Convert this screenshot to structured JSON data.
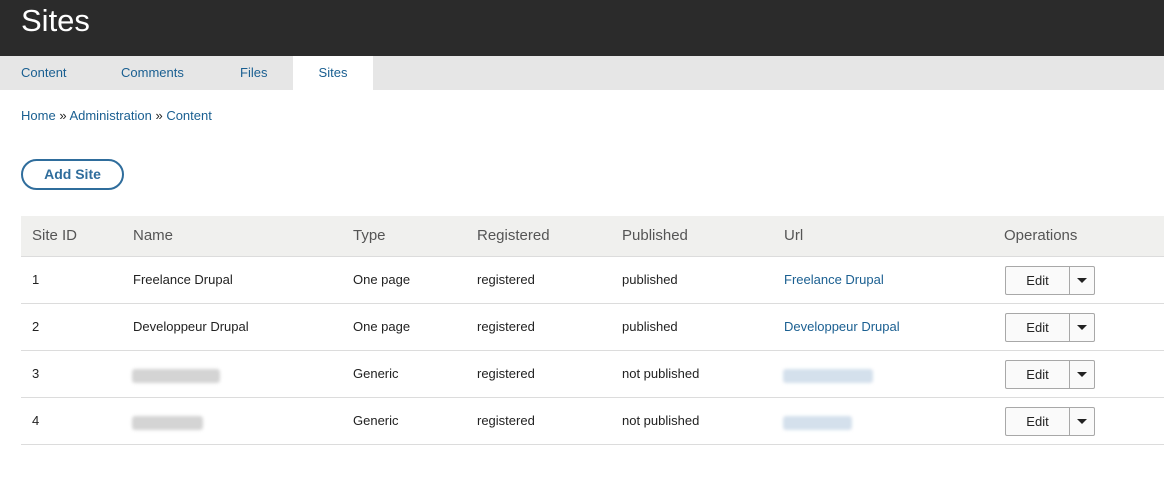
{
  "header": {
    "title": "Sites"
  },
  "tabs": [
    {
      "label": "Content"
    },
    {
      "label": "Comments"
    },
    {
      "label": "Files"
    },
    {
      "label": "Sites",
      "active": true
    }
  ],
  "breadcrumb": {
    "items": [
      "Home",
      "Administration",
      "Content"
    ],
    "separator": "»"
  },
  "actions": {
    "add_site_label": "Add Site"
  },
  "table": {
    "headers": {
      "site_id": "Site ID",
      "name": "Name",
      "type": "Type",
      "registered": "Registered",
      "published": "Published",
      "url": "Url",
      "operations": "Operations"
    },
    "rows": [
      {
        "site_id": "1",
        "name": "Freelance Drupal",
        "type": "One page",
        "registered": "registered",
        "published": "published",
        "url": "Freelance Drupal",
        "edit": "Edit"
      },
      {
        "site_id": "2",
        "name": "Developpeur Drupal",
        "type": "One page",
        "registered": "registered",
        "published": "published",
        "url": "Developpeur Drupal",
        "edit": "Edit"
      },
      {
        "site_id": "3",
        "name": "",
        "type": "Generic",
        "registered": "registered",
        "published": "not published",
        "url": "",
        "edit": "Edit",
        "redacted": true
      },
      {
        "site_id": "4",
        "name": "",
        "type": "Generic",
        "registered": "registered",
        "published": "not published",
        "url": "",
        "edit": "Edit",
        "redacted": true
      }
    ]
  },
  "colors": {
    "header_bg": "#2b2b2b",
    "link": "#1a5f91",
    "button_border": "#2f6d9c",
    "table_header_bg": "#f0f0ee"
  }
}
